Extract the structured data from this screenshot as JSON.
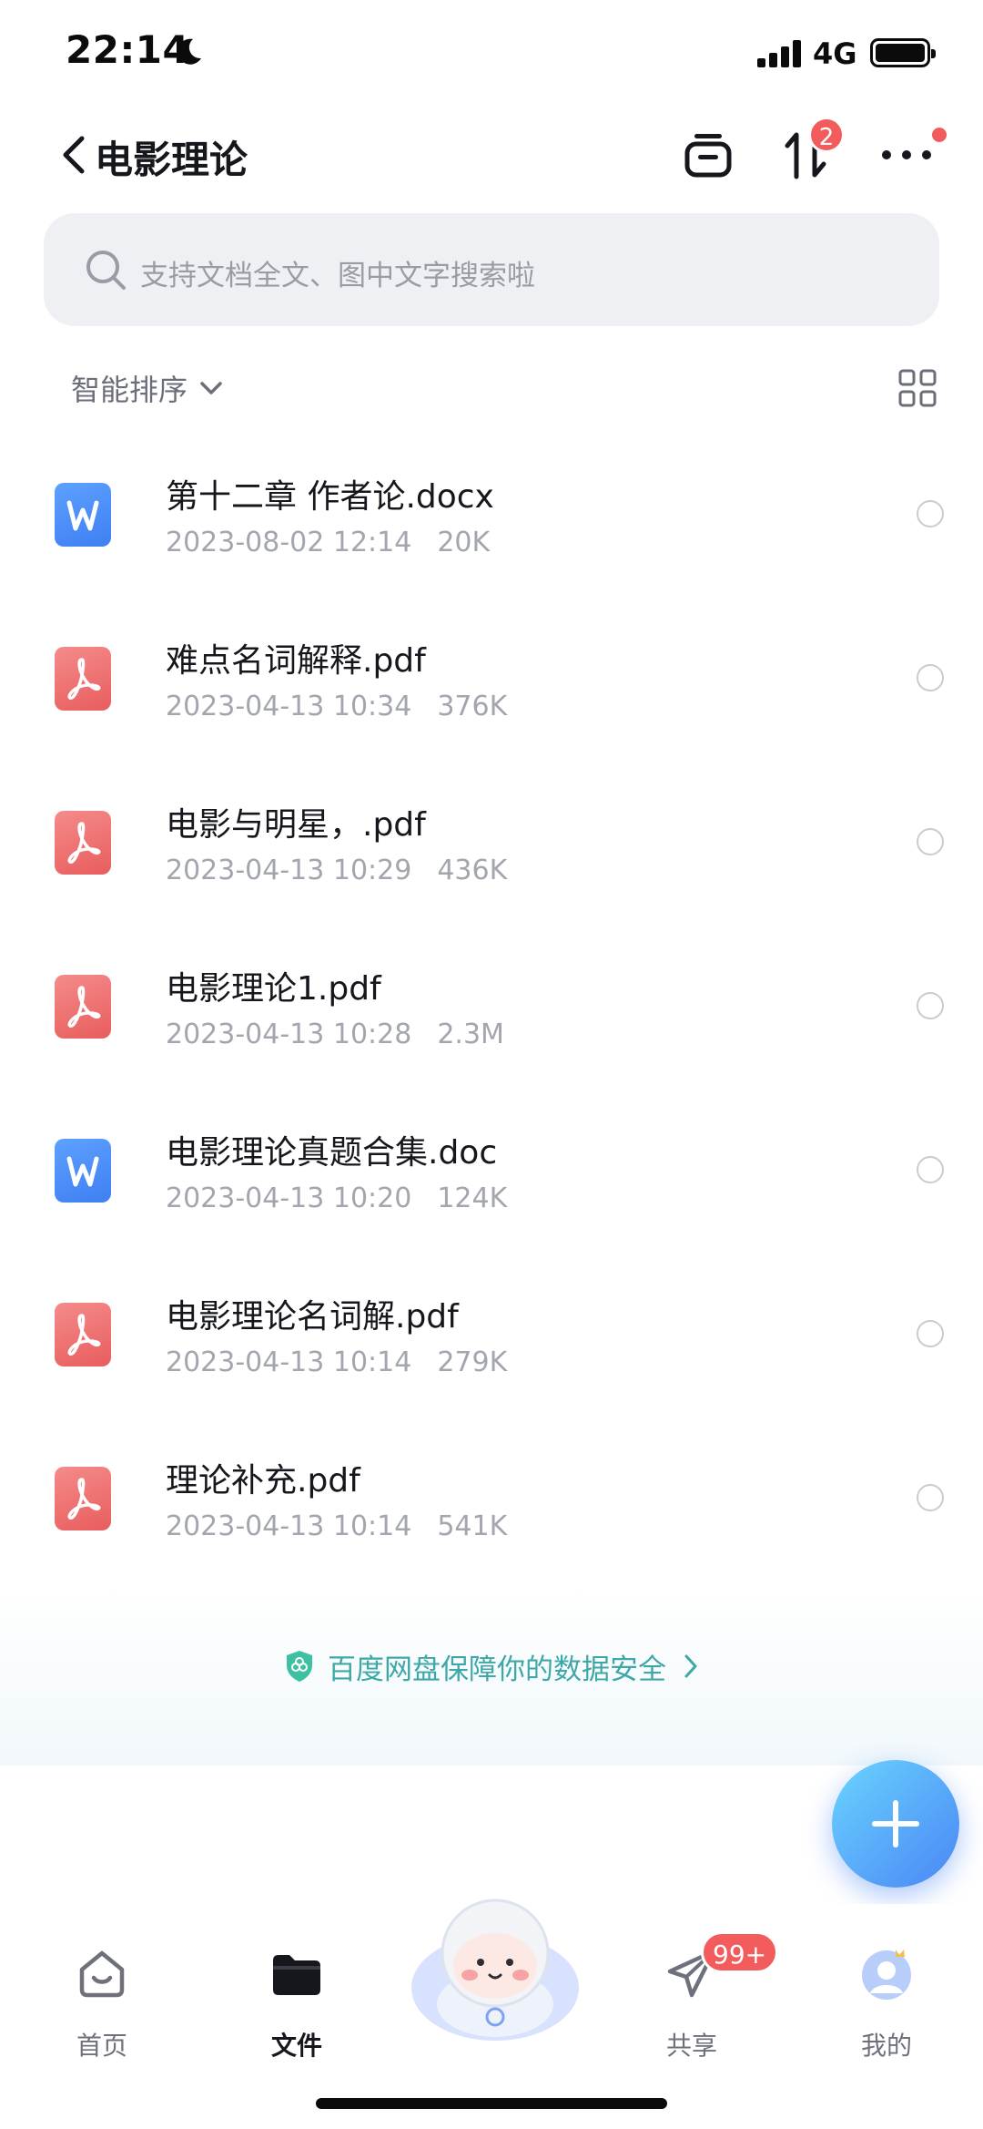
{
  "status_bar": {
    "time": "22:14",
    "network": "4G"
  },
  "header": {
    "title": "电影理论",
    "transfer_badge": "2"
  },
  "search": {
    "placeholder": "支持文档全文、图中文字搜索啦"
  },
  "sort": {
    "label": "智能排序"
  },
  "files": [
    {
      "name": "第十二章 作者论.docx",
      "date": "2023-08-02 12:14",
      "size": "20K",
      "type": "doc"
    },
    {
      "name": "难点名词解释.pdf",
      "date": "2023-04-13 10:34",
      "size": "376K",
      "type": "pdf"
    },
    {
      "name": "电影与明星，.pdf",
      "date": "2023-04-13 10:29",
      "size": "436K",
      "type": "pdf"
    },
    {
      "name": "电影理论1.pdf",
      "date": "2023-04-13 10:28",
      "size": "2.3M",
      "type": "pdf"
    },
    {
      "name": "电影理论真题合集.doc",
      "date": "2023-04-13 10:20",
      "size": "124K",
      "type": "doc"
    },
    {
      "name": "电影理论名词解.pdf",
      "date": "2023-04-13 10:14",
      "size": "279K",
      "type": "pdf"
    },
    {
      "name": "理论补充.pdf",
      "date": "2023-04-13 10:14",
      "size": "541K",
      "type": "pdf"
    }
  ],
  "security_banner": {
    "text": "百度网盘保障你的数据安全"
  },
  "bottom_nav": {
    "home": "首页",
    "files": "文件",
    "share": "共享",
    "share_badge": "99+",
    "mine": "我的"
  },
  "colors": {
    "accent": "#4a86f5",
    "badge": "#f25c5c",
    "security_text": "#3ea7a8"
  }
}
